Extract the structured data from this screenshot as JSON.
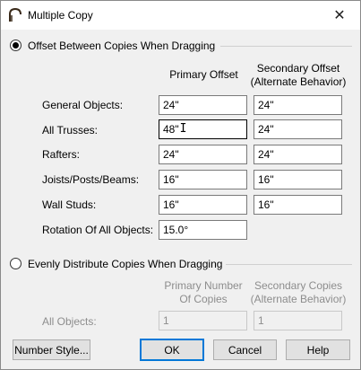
{
  "window": {
    "title": "Multiple Copy",
    "close_glyph": "✕"
  },
  "offset_section": {
    "label": "Offset Between Copies When Dragging",
    "selected": true,
    "primary_header": "Primary Offset",
    "secondary_header_line1": "Secondary Offset",
    "secondary_header_line2": "(Alternate Behavior)",
    "rows": [
      {
        "label": "General Objects:",
        "primary": "24\"",
        "secondary": "24\""
      },
      {
        "label": "All Trusses:",
        "primary": "48\"",
        "secondary": "24\""
      },
      {
        "label": "Rafters:",
        "primary": "24\"",
        "secondary": "24\""
      },
      {
        "label": "Joists/Posts/Beams:",
        "primary": "16\"",
        "secondary": "16\""
      },
      {
        "label": "Wall Studs:",
        "primary": "16\"",
        "secondary": "16\""
      }
    ],
    "rotation_label": "Rotation Of All Objects:",
    "rotation_value": "15.0°"
  },
  "distribute_section": {
    "label": "Evenly Distribute Copies When Dragging",
    "selected": false,
    "primary_header_line1": "Primary Number",
    "primary_header_line2": "Of Copies",
    "secondary_header_line1": "Secondary Copies",
    "secondary_header_line2": "(Alternate Behavior)",
    "row_label": "All Objects:",
    "primary_value": "1",
    "secondary_value": "1"
  },
  "buttons": {
    "number_style": "Number Style...",
    "ok": "OK",
    "cancel": "Cancel",
    "help": "Help"
  },
  "colors": {
    "accent": "#0078d7",
    "disabled_text": "#8d8d8d"
  },
  "icons": {
    "app": "arch-icon",
    "text_cursor": "I"
  }
}
